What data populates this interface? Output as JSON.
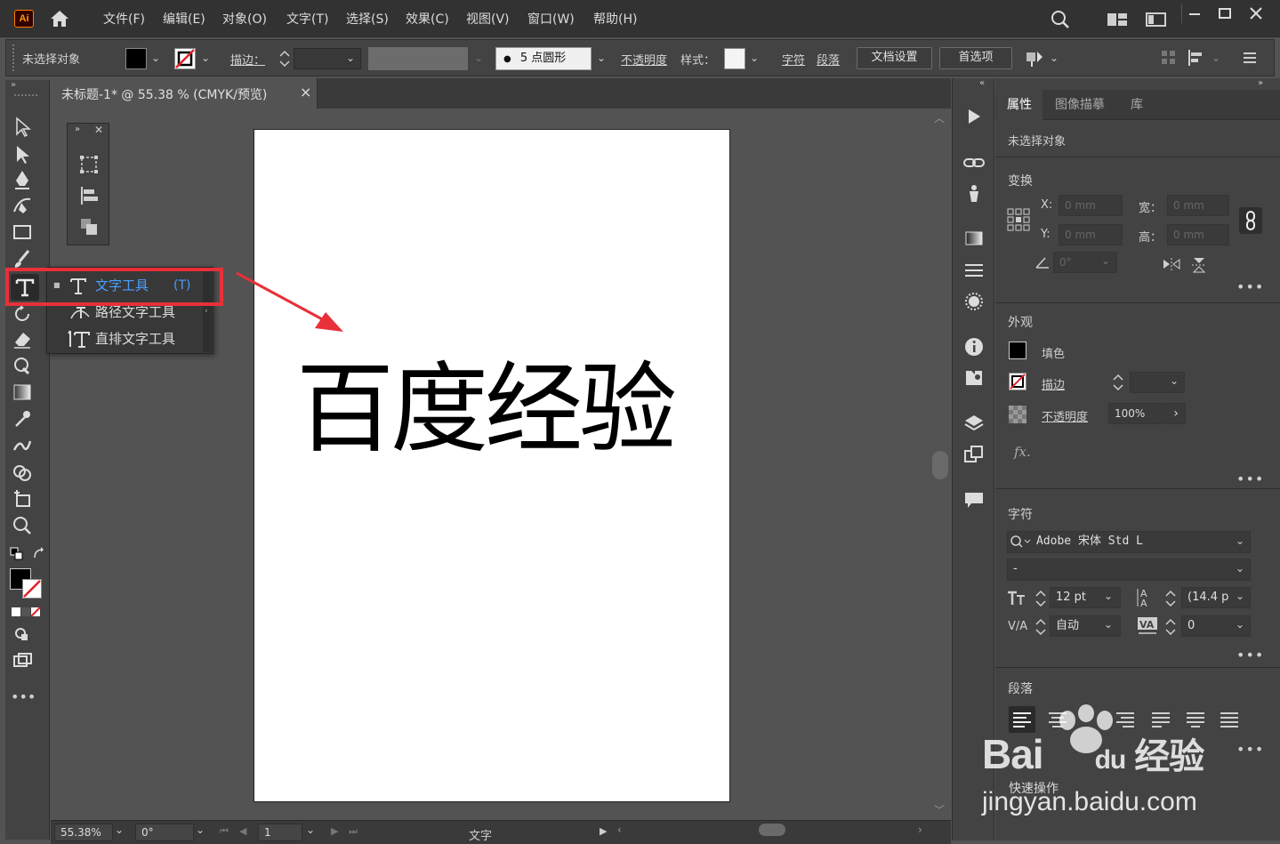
{
  "app": {
    "logo": "Ai"
  },
  "menu": [
    "文件(F)",
    "编辑(E)",
    "对象(O)",
    "文字(T)",
    "选择(S)",
    "效果(C)",
    "视图(V)",
    "窗口(W)",
    "帮助(H)"
  ],
  "control_bar": {
    "selection_status": "未选择对象",
    "stroke_label": "描边：",
    "brush_value": "5 点圆形",
    "opacity_label": "不透明度",
    "style_label": "样式：",
    "char_link": "字符",
    "para_link": "段落",
    "doc_setup_button": "文档设置",
    "prefs_button": "首选项"
  },
  "document": {
    "tab_title": "未标题-1* @ 55.38 % (CMYK/预览)",
    "close_glyph": "×",
    "artboard_text": "百度经验"
  },
  "tool_popup": {
    "items": [
      {
        "label": "文字工具",
        "shortcut": "(T)",
        "selected": true
      },
      {
        "label": "路径文字工具"
      },
      {
        "label": "直排文字工具"
      }
    ]
  },
  "status_bar": {
    "zoom": "55.38%",
    "rotation": "0°",
    "artboard_num": "1",
    "current_tool": "文字"
  },
  "right_panel": {
    "tabs": [
      "属性",
      "图像描摹",
      "库"
    ],
    "no_selection": "未选择对象",
    "transform": {
      "title": "变换",
      "x_label": "X:",
      "x_value": "0 mm",
      "y_label": "Y:",
      "y_value": "0 mm",
      "w_label": "宽：",
      "w_value": "0 mm",
      "h_label": "高：",
      "h_value": "0 mm",
      "angle_value": "0°"
    },
    "appearance": {
      "title": "外观",
      "fill_label": "填色",
      "stroke_label": "描边",
      "opacity_label": "不透明度",
      "opacity_value": "100%",
      "fx_label": "fx."
    },
    "character": {
      "title": "字符",
      "font_family": "Adobe 宋体 Std L",
      "font_style": "-",
      "font_size": "12 pt",
      "leading": "(14.4 p",
      "kerning": "自动",
      "tracking": "0"
    },
    "paragraph": {
      "title": "段落"
    }
  },
  "watermark": {
    "brand": "Bai",
    "brand2": "du",
    "product": "经验",
    "tagline": "快速操作",
    "url": "jingyan.baidu.com"
  },
  "colors": {
    "accent_red": "#e8303a",
    "selection_blue": "#4a9eff"
  }
}
